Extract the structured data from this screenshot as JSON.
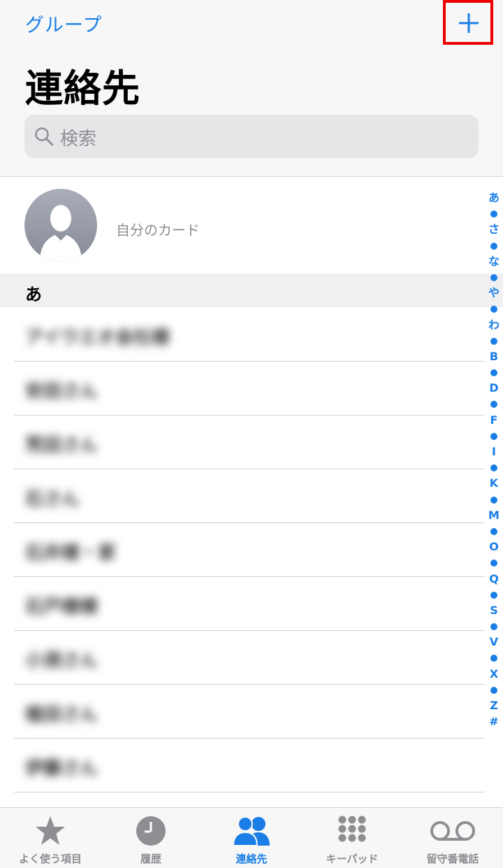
{
  "nav": {
    "groups_label": "グループ",
    "title": "連絡先",
    "add_icon": "plus-icon"
  },
  "search": {
    "placeholder": "検索",
    "icon": "search-icon"
  },
  "my_card": {
    "label": "自分のカード",
    "avatar_icon": "person-silhouette-icon"
  },
  "section": {
    "header": "あ"
  },
  "contacts": [
    {
      "name": "アイウエオ会社様"
    },
    {
      "name": "安田さん"
    },
    {
      "name": "荒田さん"
    },
    {
      "name": "石さん"
    },
    {
      "name": "石井様・家"
    },
    {
      "name": "石戸様様"
    },
    {
      "name": "小渕さん"
    },
    {
      "name": "植田さん"
    },
    {
      "name": "伊藤さん"
    }
  ],
  "index": [
    "あ",
    "•",
    "さ",
    "•",
    "な",
    "•",
    "や",
    "•",
    "わ",
    "•",
    "B",
    "•",
    "D",
    "•",
    "F",
    "•",
    "I",
    "•",
    "K",
    "•",
    "M",
    "•",
    "O",
    "•",
    "Q",
    "•",
    "S",
    "•",
    "V",
    "•",
    "X",
    "•",
    "Z",
    "#"
  ],
  "tabs": [
    {
      "label": "よく使う項目",
      "icon": "star-icon",
      "active": false
    },
    {
      "label": "履歴",
      "icon": "clock-icon",
      "active": false
    },
    {
      "label": "連絡先",
      "icon": "contacts-icon",
      "active": true
    },
    {
      "label": "キーパッド",
      "icon": "keypad-icon",
      "active": false
    },
    {
      "label": "留守番電話",
      "icon": "voicemail-icon",
      "active": false
    }
  ],
  "colors": {
    "accent": "#1a7ee6",
    "highlight": "#ee0000",
    "inactive": "#8e8e93"
  }
}
